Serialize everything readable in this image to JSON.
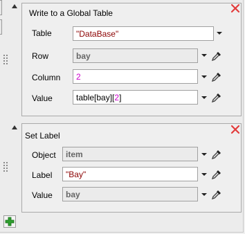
{
  "panels": [
    {
      "title": "Write to a Global Table",
      "rows": [
        {
          "label": "Table",
          "value": "\"DataBase\""
        },
        {
          "label": "Row",
          "value": "bay"
        },
        {
          "label": "Column",
          "value": "2"
        },
        {
          "label": "Value",
          "value_parts": [
            "table[",
            "bay",
            "][",
            "2",
            "]"
          ]
        }
      ]
    },
    {
      "title": "Set Label",
      "rows": [
        {
          "label": "Object",
          "value": "item"
        },
        {
          "label": "Label",
          "value": "\"Bay\""
        },
        {
          "label": "Value",
          "value": "bay"
        }
      ]
    }
  ],
  "colors": {
    "close": "#e23b3b",
    "add": "#2e9e2e",
    "string": "#8b0000",
    "number": "#cc00cc"
  },
  "icons": [
    "collapse-arrow-icon",
    "close-icon",
    "grip-icon",
    "dropdown-icon",
    "eyedropper-icon",
    "add-icon"
  ]
}
